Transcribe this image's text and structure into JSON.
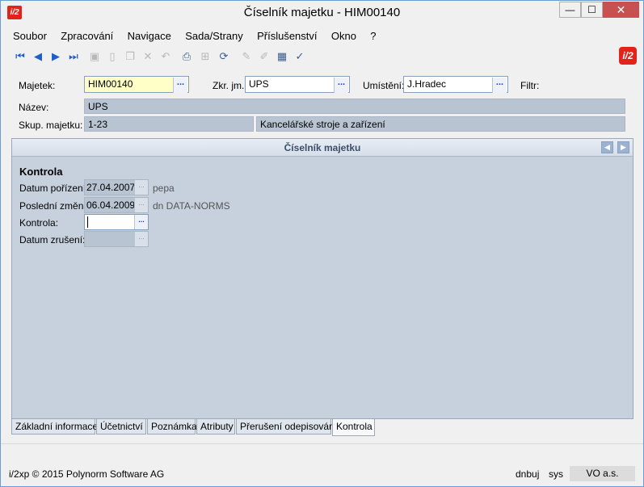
{
  "window": {
    "title": "Číselník majetku - HIM00140",
    "app_icon_text": "i/2",
    "min_glyph": "—",
    "max_glyph": "☐",
    "close_glyph": "✕"
  },
  "menu": [
    "Soubor",
    "Zpracování",
    "Navigace",
    "Sada/Strany",
    "Příslušenství",
    "Okno",
    "?"
  ],
  "toolbar": {
    "icons": [
      "first-record-icon",
      "previous-record-icon",
      "next-record-icon",
      "last-record-icon",
      "save-icon",
      "new-icon",
      "copy-icon",
      "delete-icon",
      "undo-icon",
      "print-icon",
      "tree-icon",
      "refresh-icon",
      "edit-icon",
      "pencil-icon",
      "table-icon",
      "filter-check-icon"
    ],
    "logo_text": "i/2"
  },
  "header": {
    "majetek_label": "Majetek:",
    "majetek_value": "HIM00140",
    "zkr_label": "Zkr. jm.:",
    "zkr_value": "UPS",
    "umisteni_label": "Umístění:",
    "umisteni_value": "J.Hradec",
    "filtr_label": "Filtr:",
    "nazev_label": "Název:",
    "nazev_value": "UPS",
    "skup_label": "Skup. majetku:",
    "skup_code": "1-23",
    "skup_name": "Kancelářské stroje a zařízení",
    "ellipsis": "..."
  },
  "panel": {
    "title": "Číselník majetku",
    "section": "Kontrola",
    "fields": {
      "datum_porizeni_label": "Datum pořízení:",
      "datum_porizeni_value": "27.04.2007",
      "datum_porizeni_user": "pepa",
      "posledni_zmena_label": "Poslední změna:",
      "posledni_zmena_value": "06.04.2009",
      "posledni_zmena_user": "dn  DATA-NORMS",
      "kontrola_label": "Kontrola:",
      "kontrola_value": "",
      "datum_zruseni_label": "Datum zrušení:",
      "datum_zruseni_value": ""
    }
  },
  "tabs": [
    "Základní informace",
    "Účetnictví",
    "Poznámka",
    "Atributy",
    "Přerušení odepisování",
    "Kontrola"
  ],
  "status": {
    "copyright": "i/2xp © 2015 Polynorm Software AG",
    "user": "dnbuj",
    "system": "sys",
    "company": "VO a.s."
  }
}
